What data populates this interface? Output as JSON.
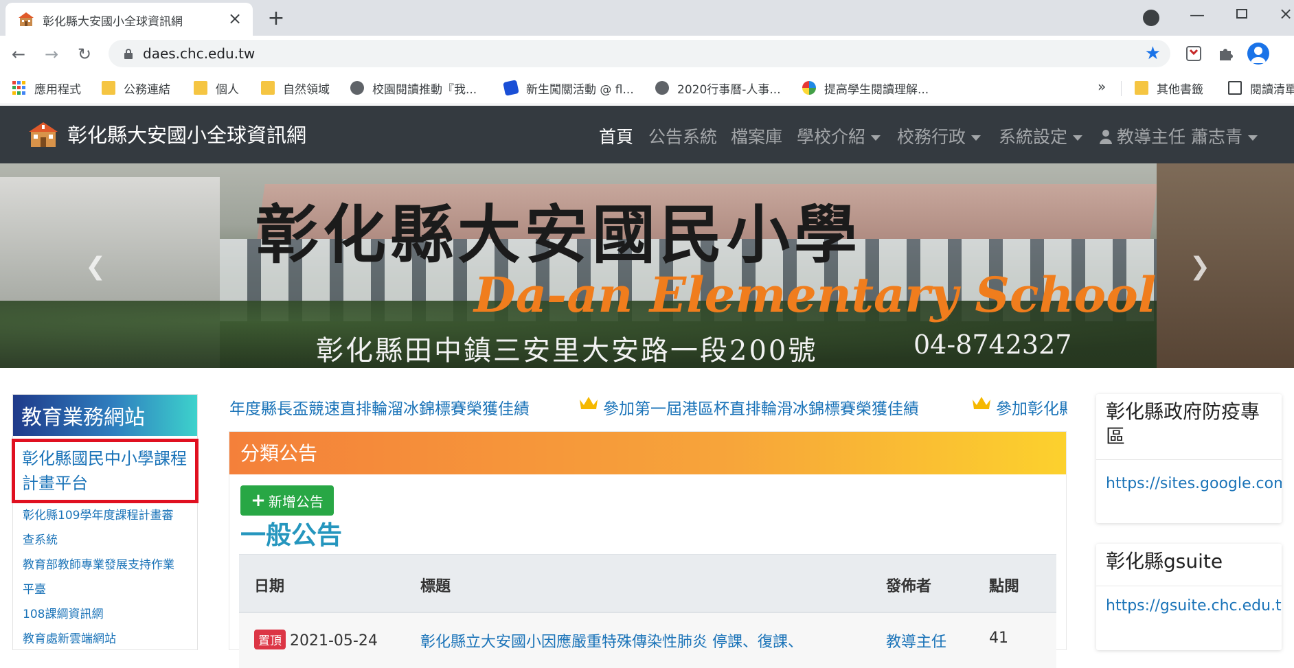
{
  "browser": {
    "tab_title": "彰化縣大安國小全球資訊網",
    "url": "daes.chc.edu.tw",
    "bookmarks": [
      {
        "label": "應用程式",
        "icon": "apps-grid-icon"
      },
      {
        "label": "公務連結",
        "icon": "folder-icon"
      },
      {
        "label": "個人",
        "icon": "folder-icon"
      },
      {
        "label": "自然領域",
        "icon": "folder-icon"
      },
      {
        "label": "校園閱讀推動『我...",
        "icon": "globe-icon"
      },
      {
        "label": "新生闖關活動 @ fl...",
        "icon": "blue-bookmark-icon"
      },
      {
        "label": "2020行事曆-人事...",
        "icon": "globe-icon"
      },
      {
        "label": "提高學生閱讀理解...",
        "icon": "pinwheel-icon"
      }
    ],
    "bookmarks_more": "»",
    "other_bookmarks": "其他書籤",
    "reading_list": "閱讀清單"
  },
  "site": {
    "brand": "彰化縣大安國小全球資訊網",
    "nav": [
      {
        "label": "首頁"
      },
      {
        "label": "公告系統"
      },
      {
        "label": "檔案庫"
      },
      {
        "label": "學校介紹"
      },
      {
        "label": "校務行政"
      },
      {
        "label": "系統設定"
      },
      {
        "label": "教導主任 蕭志青"
      }
    ]
  },
  "banner": {
    "title_cn": "彰化縣大安國民小學",
    "title_en": "Da-an Elementary School",
    "address": "彰化縣田中鎮三安里大安路一段200號",
    "phone": "04-8742327"
  },
  "sidebar": {
    "title": "教育業務網站",
    "highlight": "彰化縣國民中小學課程計畫平台",
    "links": [
      "彰化縣109學年度課程計畫審",
      "查系統",
      "教育部教師專業發展支持作業",
      "平臺",
      "108課綱資訊網",
      "教育處新雲端網站"
    ]
  },
  "marquee": {
    "items": [
      "年度縣長盃競速直排輪溜冰錦標賽榮獲佳績",
      "參加第一屆港區杯直排輪滑冰錦標賽榮獲佳績",
      "參加彰化縣"
    ]
  },
  "announcements": {
    "panel_title": "分類公告",
    "add_button": "新增公告",
    "section_title": "一般公告",
    "columns": [
      "日期",
      "標題",
      "發佈者",
      "點閱"
    ],
    "rows": [
      {
        "badge": "置頂",
        "date": "2021-05-24",
        "title": "彰化縣立大安國小因應嚴重特殊傳染性肺炎 停課、復課、",
        "author": "教導主任",
        "views": "41"
      }
    ]
  },
  "right_cards": [
    {
      "title": "彰化縣政府防疫專區",
      "link": "https://sites.google.com/c"
    },
    {
      "title": "彰化縣gsuite",
      "link": "https://gsuite.chc.edu.tw/"
    }
  ],
  "colors": {
    "navbar": "#343a40",
    "link": "#1a73b8",
    "add_button": "#28a745",
    "highlight_border": "#e01020",
    "pin_badge": "#dc3545"
  }
}
